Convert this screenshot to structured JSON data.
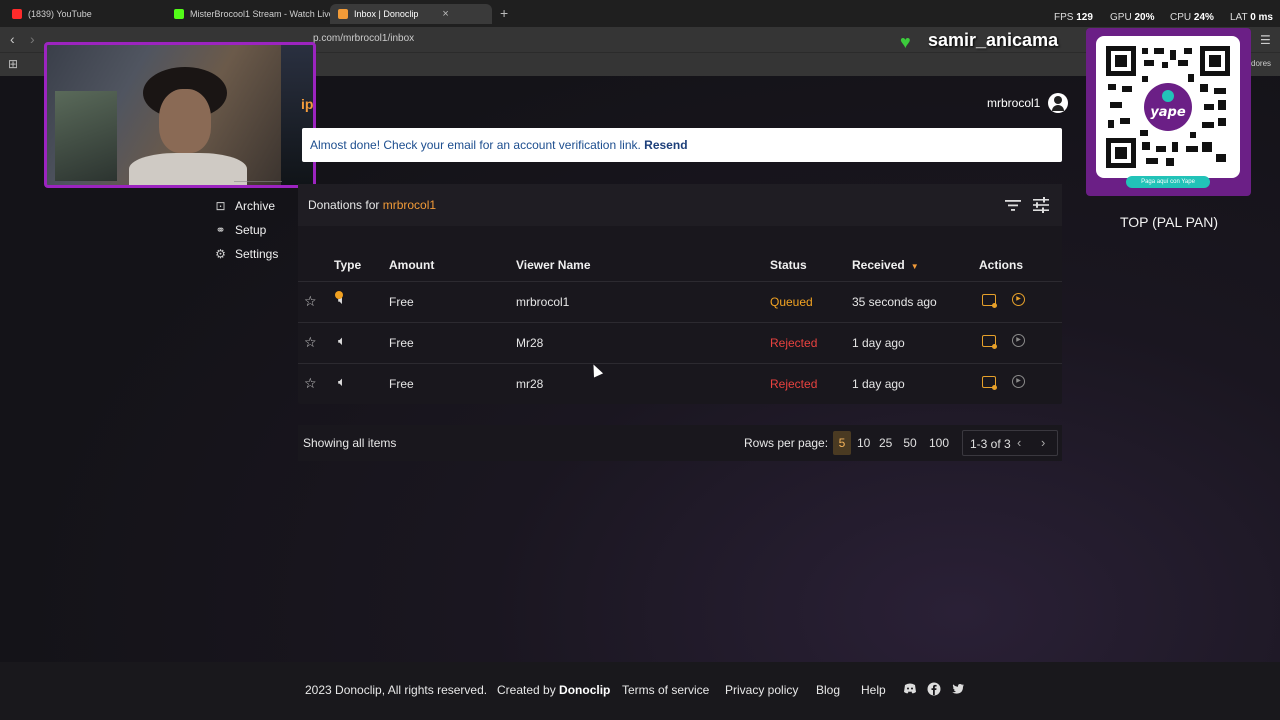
{
  "browser": {
    "tabs": [
      {
        "label": "(1839) YouTube",
        "color": "#ff2b2b"
      },
      {
        "label": "MisterBrocool1 Stream - Watch Live",
        "color": "#53fc18"
      },
      {
        "label": "Inbox | Donoclip",
        "color": "#f29b38"
      }
    ],
    "new_tab": "+",
    "close_tab": "×",
    "url": "p.com/mrbrocol1/inbox",
    "stats": {
      "fps_label": "FPS",
      "fps_value": "129",
      "gpu_label": "GPU",
      "gpu_value": "20%",
      "cpu_label": "CPU",
      "cpu_value": "24%",
      "lat_label": "LAT",
      "lat_value": "0 ms"
    },
    "bookmarks_fragment": "dores"
  },
  "stream_overlay": {
    "streamer_name": "samir_anicama",
    "qr_caption": "Paga aquí con Yape",
    "side_label": "TOP (PAL PAN)"
  },
  "header": {
    "logo_fragment": "ip",
    "username": "mrbrocol1"
  },
  "banner": {
    "message": "Almost done! Check your email for an account verification link.",
    "action": "Resend"
  },
  "sidebar": {
    "items": [
      {
        "label": "Archive",
        "icon": "archive-icon"
      },
      {
        "label": "Setup",
        "icon": "link-icon"
      },
      {
        "label": "Settings",
        "icon": "gear-icon"
      }
    ]
  },
  "inbox": {
    "title_prefix": "Donations for",
    "title_user": "mrbrocol1",
    "columns": {
      "type": "Type",
      "amount": "Amount",
      "viewer": "Viewer Name",
      "status": "Status",
      "received": "Received",
      "actions": "Actions"
    },
    "rows": [
      {
        "amount": "Free",
        "viewer": "mrbrocol1",
        "status": "Queued",
        "received": "35 seconds ago"
      },
      {
        "amount": "Free",
        "viewer": "Mr28",
        "status": "Rejected",
        "received": "1 day ago"
      },
      {
        "amount": "Free",
        "viewer": "mr28",
        "status": "Rejected",
        "received": "1 day ago"
      }
    ],
    "status_colors": {
      "Queued": "#f2a322",
      "Rejected": "#e8423f"
    },
    "showing": "Showing all items",
    "rows_per_page_label": "Rows per page:",
    "page_sizes": [
      "5",
      "10",
      "25",
      "50",
      "100"
    ],
    "selected_page_size": "5",
    "range": "1-3 of 3"
  },
  "footer": {
    "copyright": "2023 Donoclip, All rights reserved.",
    "created_by_prefix": "Created by",
    "created_by": "Donoclip",
    "terms": "Terms of service",
    "privacy": "Privacy policy",
    "blog": "Blog",
    "help": "Help"
  }
}
